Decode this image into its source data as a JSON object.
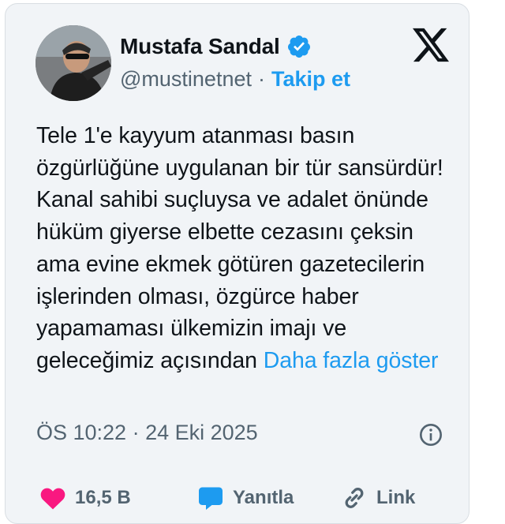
{
  "user": {
    "name": "Mustafa Sandal",
    "handle": "@mustinetnet",
    "separator": "·",
    "follow_label": "Takip et"
  },
  "tweet": {
    "text": "Tele 1'e kayyum atanması basın özgürlüğüne uygulanan bir tür sansürdür! Kanal sahibi suçluysa ve adalet önünde hüküm giyerse elbette cezasını çeksin ama evine ekmek götüren gazetecilerin işlerinden olması, özgürce haber yapamaması ülkemizin imajı ve geleceğimiz açısından",
    "show_more": "Daha fazla göster",
    "timestamp": "ÖS 10:22 · 24 Eki 2025"
  },
  "actions": {
    "likes": "16,5 B",
    "reply_label": "Yanıtla",
    "link_label": "Link"
  },
  "colors": {
    "accent": "#1d9bf0",
    "like": "#f91880",
    "card_bg": "#f1f4f7",
    "text": "#0f1419",
    "muted": "#536471"
  },
  "icons": [
    "avatar",
    "verified-badge-icon",
    "x-logo-icon",
    "info-icon",
    "heart-icon",
    "reply-icon",
    "link-icon"
  ]
}
